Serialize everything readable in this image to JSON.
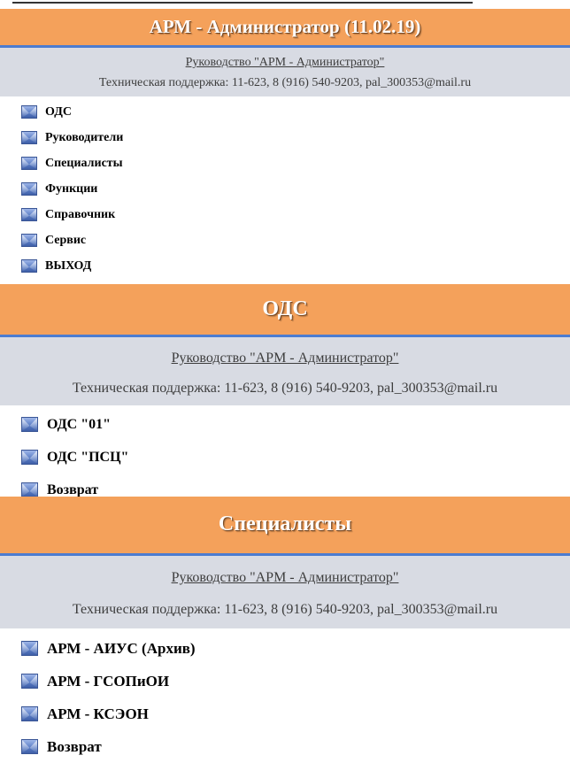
{
  "colors": {
    "header_bg": "#f4a15b",
    "header_border": "#4c7cd0",
    "info_bg": "#d8dbe3",
    "text": "#000000"
  },
  "icon": "blue-envelope-icon",
  "sections": [
    {
      "title": "АРМ - Администратор (11.02.19)",
      "guide_link": "Руководство \"АРМ - Администратор\"",
      "support": "Техническая поддержка: 11-623, 8 (916) 540-9203, pal_300353@mail.ru",
      "items": [
        "ОДС",
        "Руководители",
        "Специалисты",
        "Функции",
        "Справочник",
        "Сервис",
        "ВЫХОД"
      ]
    },
    {
      "title": "ОДС",
      "guide_link": "Руководство \"АРМ - Администратор\"",
      "support": "Техническая поддержка: 11-623, 8 (916) 540-9203, pal_300353@mail.ru",
      "items": [
        "ОДС \"01\"",
        "ОДС \"ПСЦ\"",
        "Возврат"
      ]
    },
    {
      "title": "Специалисты",
      "guide_link": "Руководство \"АРМ - Администратор\"",
      "support": "Техническая поддержка: 11-623, 8 (916) 540-9203, pal_300353@mail.ru",
      "items": [
        "АРМ - АИУС (Архив)",
        "АРМ - ГСОПиОИ",
        "АРМ - КСЭОН",
        "Возврат"
      ]
    }
  ]
}
